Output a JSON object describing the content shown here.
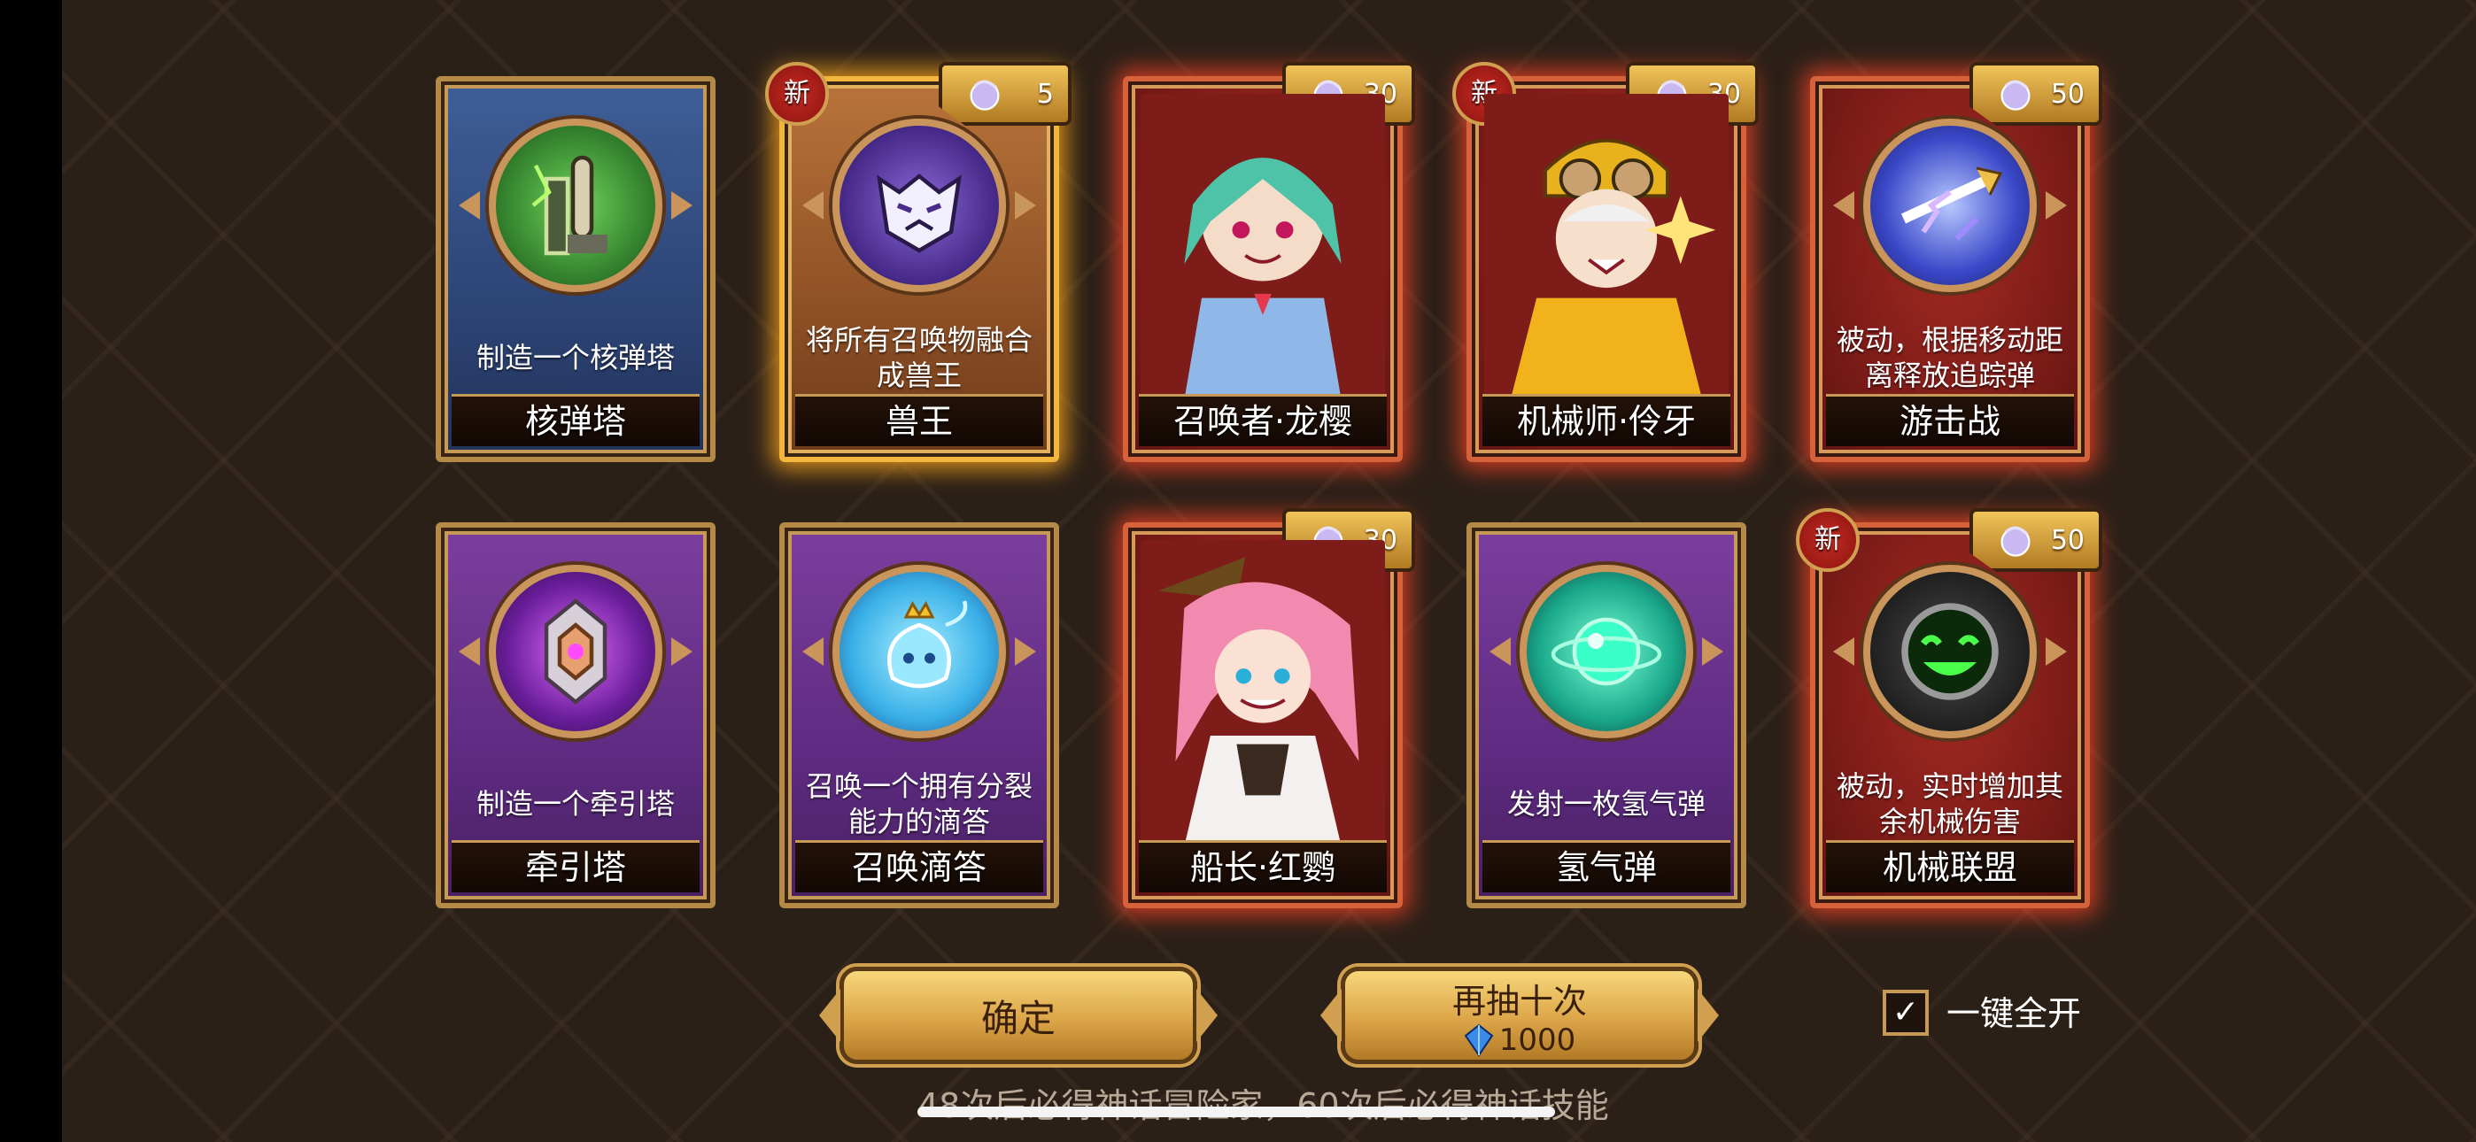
{
  "cards": [
    {
      "id": "c1",
      "name": "核弹塔",
      "desc": "制造一个核弹塔",
      "style": "blue",
      "icon": "nuke-tower-icon",
      "cost": null,
      "isNew": false
    },
    {
      "id": "c2",
      "name": "兽王",
      "desc": "将所有召唤物融合成兽王",
      "style": "gold",
      "icon": "beast-king-icon",
      "cost": "5",
      "isNew": true
    },
    {
      "id": "c3",
      "name": "召唤者·龙樱",
      "desc": "",
      "style": "red",
      "icon": "summoner-portrait",
      "cost": "30",
      "isNew": false
    },
    {
      "id": "c4",
      "name": "机械师·伶牙",
      "desc": "",
      "style": "red",
      "icon": "mechanic-portrait",
      "cost": "30",
      "isNew": true
    },
    {
      "id": "c5",
      "name": "游击战",
      "desc": "被动，根据移动距离释放追踪弹",
      "style": "red",
      "icon": "guerrilla-icon",
      "cost": "50",
      "isNew": false
    },
    {
      "id": "c6",
      "name": "牵引塔",
      "desc": "制造一个牵引塔",
      "style": "purple",
      "icon": "traction-tower-icon",
      "cost": null,
      "isNew": false
    },
    {
      "id": "c7",
      "name": "召唤滴答",
      "desc": "召唤一个拥有分裂能力的滴答",
      "style": "purple",
      "icon": "ticktock-icon",
      "cost": null,
      "isNew": false
    },
    {
      "id": "c8",
      "name": "船长·红鹦",
      "desc": "",
      "style": "red",
      "icon": "captain-portrait",
      "cost": "30",
      "isNew": false
    },
    {
      "id": "c9",
      "name": "氢气弹",
      "desc": "发射一枚氢气弹",
      "style": "purple",
      "icon": "hydrogen-bomb-icon",
      "cost": null,
      "isNew": false
    },
    {
      "id": "c10",
      "name": "机械联盟",
      "desc": "被动，实时增加其余机械伤害",
      "style": "red",
      "icon": "mech-alliance-icon",
      "cost": "50",
      "isNew": true
    }
  ],
  "badges": {
    "new_label": "新"
  },
  "buttons": {
    "confirm_label": "确定",
    "redraw_label": "再抽十次",
    "redraw_cost": "1000"
  },
  "auto_open": {
    "label": "一键全开",
    "checked": true,
    "check_glyph": "✓"
  },
  "footer": {
    "note": "48次后必得神话冒险家，60次后必得神话技能"
  },
  "colors": {
    "gold": "#f2b63c",
    "red_glow": "#ff4628",
    "purple": "#5f2b82",
    "blue": "#2d4476"
  }
}
